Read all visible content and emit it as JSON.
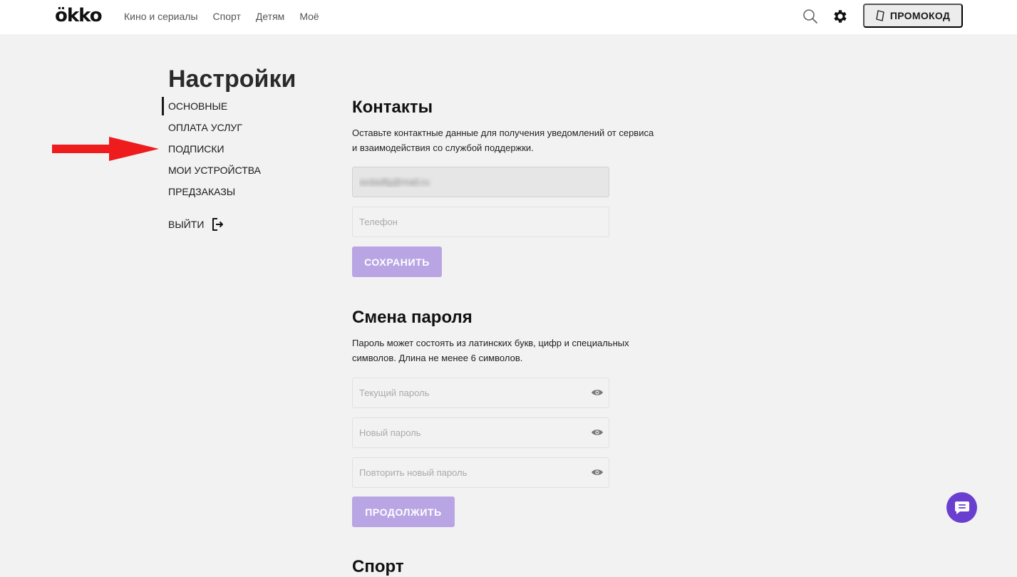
{
  "header": {
    "logo": "ökko",
    "nav": [
      "Кино и сериалы",
      "Спорт",
      "Детям",
      "Моё"
    ],
    "promo_label": "ПРОМОКОД",
    "icons": [
      "search-icon",
      "gear-icon",
      "promo-ticket-icon"
    ]
  },
  "sidebar": {
    "title": "Настройки",
    "items": [
      {
        "label": "ОСНОВНЫЕ",
        "active": true
      },
      {
        "label": "ОПЛАТА УСЛУГ",
        "active": false
      },
      {
        "label": "ПОДПИСКИ",
        "active": false
      },
      {
        "label": "МОИ УСТРОЙСТВА",
        "active": false
      },
      {
        "label": "ПРЕДЗАКАЗЫ",
        "active": false
      }
    ],
    "logout_label": "ВЫЙТИ",
    "annotation_arrow_color": "#ee1c1c"
  },
  "contacts": {
    "title": "Контакты",
    "description_line1": "Оставьте контактные данные для получения уведомлений от сервиса",
    "description_line2": "и взаимодействия со службой поддержки.",
    "email_value": "avdadfg@mail.ru",
    "phone_placeholder": "Телефон",
    "save_label": "СОХРАНИТЬ"
  },
  "password": {
    "title": "Смена пароля",
    "description_line1": "Пароль может состоять из латинских букв, цифр и специальных",
    "description_line2": "символов. Длина не менее 6 символов.",
    "current_placeholder": "Текущий пароль",
    "new_placeholder": "Новый пароль",
    "repeat_placeholder": "Повторить новый пароль",
    "continue_label": "ПРОДОЛЖИТЬ"
  },
  "sport": {
    "title": "Спорт"
  },
  "colors": {
    "accent": "#6a3fd0",
    "button_disabled": "#b9a5e4",
    "background": "#f2f2f2"
  }
}
